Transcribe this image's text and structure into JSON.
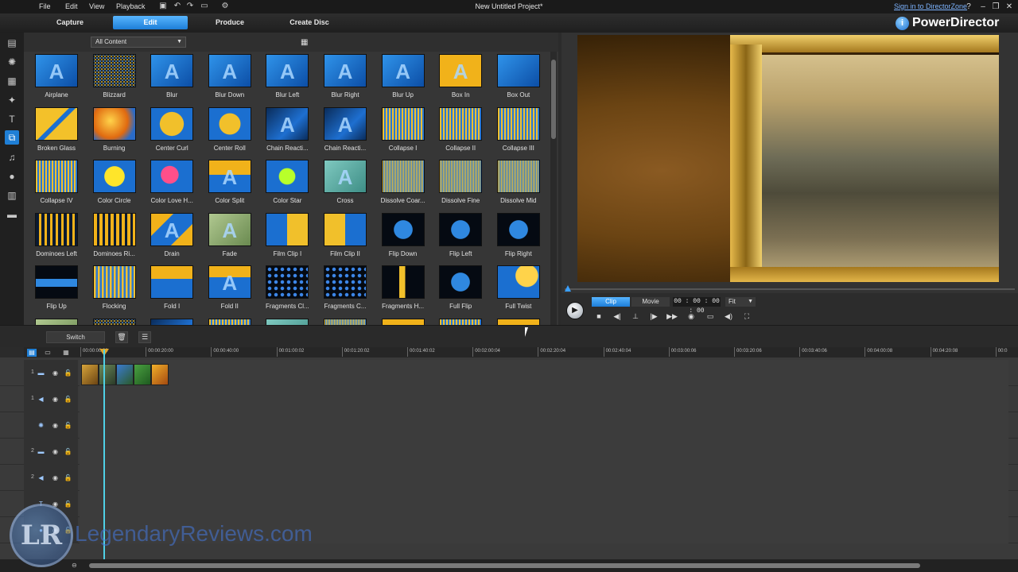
{
  "menu": {
    "items": [
      "File",
      "Edit",
      "View",
      "Playback"
    ]
  },
  "window": {
    "title": "New Untitled Project*",
    "signin": "Sign in to DirectorZone"
  },
  "tabs": {
    "items": [
      "Capture",
      "Edit",
      "Produce",
      "Create Disc"
    ],
    "active": "Edit"
  },
  "brand": {
    "name": "PowerDirector"
  },
  "library": {
    "filter": "All Content",
    "transitions": [
      {
        "label": "Airplane",
        "style": "blue",
        "glyph": "A"
      },
      {
        "label": "Blizzard",
        "style": "noise",
        "glyph": ""
      },
      {
        "label": "Blur",
        "style": "blue",
        "glyph": "A"
      },
      {
        "label": "Blur Down",
        "style": "blue",
        "glyph": "A"
      },
      {
        "label": "Blur Left",
        "style": "blue",
        "glyph": "A"
      },
      {
        "label": "Blur Right",
        "style": "blue",
        "glyph": "A"
      },
      {
        "label": "Blur Up",
        "style": "blue",
        "glyph": "A"
      },
      {
        "label": "Box In",
        "style": "boxin",
        "glyph": "A"
      },
      {
        "label": "Box Out",
        "style": "boxout",
        "glyph": ""
      },
      {
        "label": "Broken Glass",
        "style": "broken",
        "glyph": ""
      },
      {
        "label": "Burning",
        "style": "burning",
        "glyph": ""
      },
      {
        "label": "Center Curl",
        "style": "curl",
        "glyph": ""
      },
      {
        "label": "Center Roll",
        "style": "roll",
        "glyph": ""
      },
      {
        "label": "Chain Reacti...",
        "style": "chain",
        "glyph": "A"
      },
      {
        "label": "Chain Reacti...",
        "style": "chain",
        "glyph": "A"
      },
      {
        "label": "Collapse I",
        "style": "mosaic",
        "glyph": ""
      },
      {
        "label": "Collapse II",
        "style": "mosaic",
        "glyph": ""
      },
      {
        "label": "Collapse III",
        "style": "mosaic",
        "glyph": ""
      },
      {
        "label": "Collapse IV",
        "style": "mosaic",
        "glyph": ""
      },
      {
        "label": "Color Circle",
        "style": "circle",
        "glyph": ""
      },
      {
        "label": "Color Love H...",
        "style": "heart",
        "glyph": ""
      },
      {
        "label": "Color Split",
        "style": "split",
        "glyph": "A"
      },
      {
        "label": "Color Star",
        "style": "star",
        "glyph": ""
      },
      {
        "label": "Cross",
        "style": "cross",
        "glyph": "A"
      },
      {
        "label": "Dissolve Coar...",
        "style": "dissolve",
        "glyph": ""
      },
      {
        "label": "Dissolve Fine",
        "style": "dissolve",
        "glyph": ""
      },
      {
        "label": "Dissolve Mid",
        "style": "dissolve",
        "glyph": ""
      },
      {
        "label": "Dominoes Left",
        "style": "dominoes",
        "glyph": ""
      },
      {
        "label": "Dominoes Ri...",
        "style": "dominoesR",
        "glyph": ""
      },
      {
        "label": "Drain",
        "style": "drain",
        "glyph": "A"
      },
      {
        "label": "Fade",
        "style": "fade",
        "glyph": "A"
      },
      {
        "label": "Film Clip I",
        "style": "film",
        "glyph": ""
      },
      {
        "label": "Film Clip II",
        "style": "film2",
        "glyph": ""
      },
      {
        "label": "Flip Down",
        "style": "flip",
        "glyph": ""
      },
      {
        "label": "Flip Left",
        "style": "flip",
        "glyph": ""
      },
      {
        "label": "Flip Right",
        "style": "flip",
        "glyph": ""
      },
      {
        "label": "Flip Up",
        "style": "flipup",
        "glyph": ""
      },
      {
        "label": "Flocking",
        "style": "flocking",
        "glyph": ""
      },
      {
        "label": "Fold I",
        "style": "fold",
        "glyph": ""
      },
      {
        "label": "Fold II",
        "style": "fold2",
        "glyph": "A"
      },
      {
        "label": "Fragments Cl...",
        "style": "fragments",
        "glyph": ""
      },
      {
        "label": "Fragments C...",
        "style": "fragments",
        "glyph": ""
      },
      {
        "label": "Fragments H...",
        "style": "fragmentsH",
        "glyph": ""
      },
      {
        "label": "Full Flip",
        "style": "flip",
        "glyph": ""
      },
      {
        "label": "Full Twist",
        "style": "twist",
        "glyph": ""
      }
    ]
  },
  "preview": {
    "modes": [
      "Clip",
      "Movie"
    ],
    "active_mode": "Clip",
    "timecode": "00 : 00 : 00 : 00",
    "fit": "Fit",
    "position": 0
  },
  "timeline": {
    "switch_label": "Switch",
    "ruler": [
      "00:00:00:00",
      "00:00:20:00",
      "00:00:40:00",
      "00:01:00:02",
      "00:01:20:02",
      "00:01:40:02",
      "00:02:00:04",
      "00:02:20:04",
      "00:02:40:04",
      "00:03:00:06",
      "00:03:20:06",
      "00:03:40:06",
      "00:04:00:08",
      "00:04:20:08",
      "00:0"
    ],
    "tracks": [
      {
        "num": "1",
        "kind": "video"
      },
      {
        "num": "1",
        "kind": "audio"
      },
      {
        "num": "",
        "kind": "fx"
      },
      {
        "num": "2",
        "kind": "video"
      },
      {
        "num": "2",
        "kind": "audio"
      },
      {
        "num": "",
        "kind": "title"
      },
      {
        "num": "",
        "kind": "voice"
      }
    ]
  },
  "watermark": {
    "logo": "LR",
    "text": "LegendaryReviews.com"
  }
}
